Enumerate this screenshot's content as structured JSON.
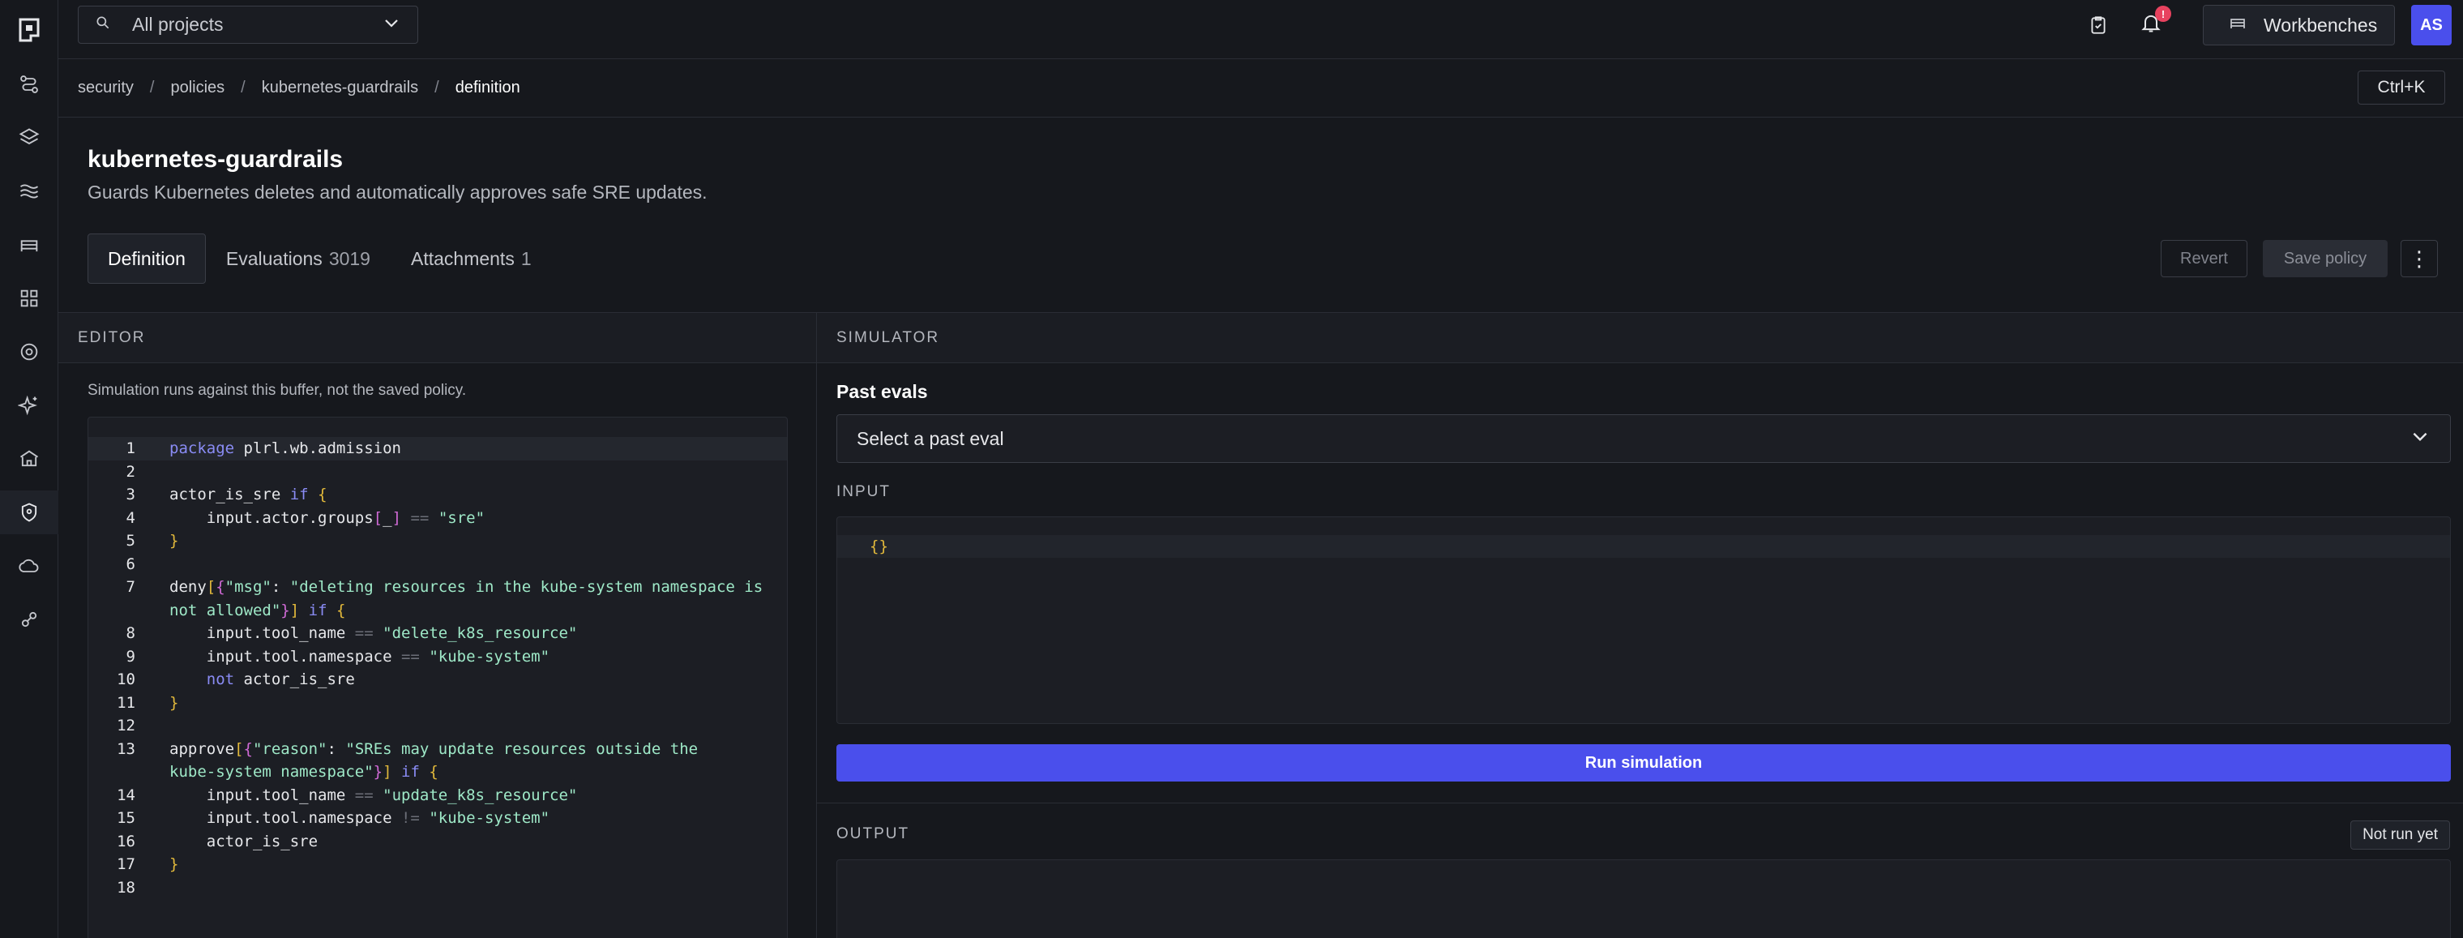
{
  "topbar": {
    "project_select": "All projects",
    "notification_badge": "!",
    "workbenches_label": "Workbenches",
    "avatar_initials": "AS"
  },
  "breadcrumb": {
    "items": [
      "security",
      "policies",
      "kubernetes-guardrails",
      "definition"
    ],
    "separator": "/",
    "shortcut": "Ctrl+K"
  },
  "header": {
    "title": "kubernetes-guardrails",
    "subtitle": "Guards Kubernetes deletes and automatically approves safe SRE updates.",
    "tabs": [
      {
        "label": "Definition",
        "count": ""
      },
      {
        "label": "Evaluations",
        "count": "3019"
      },
      {
        "label": "Attachments",
        "count": "1"
      }
    ],
    "revert_label": "Revert",
    "save_label": "Save policy",
    "more_label": "⋮"
  },
  "editor": {
    "heading": "EDITOR",
    "note": "Simulation runs against this buffer, not the saved policy.",
    "line_numbers": [
      "1",
      "2",
      "3",
      "4",
      "5",
      "6",
      "7",
      "",
      "8",
      "9",
      "10",
      "11",
      "12",
      "13",
      "",
      "14",
      "15",
      "16",
      "17",
      "18"
    ]
  },
  "simulator": {
    "heading": "SIMULATOR",
    "past_evals_label": "Past evals",
    "select_placeholder": "Select a past eval",
    "input_label": "INPUT",
    "input_value": "{}",
    "run_label": "Run simulation",
    "output_label": "OUTPUT",
    "output_status": "Not run yet"
  },
  "colors": {
    "accent": "#4a4fec",
    "background": "#16181d",
    "keyword": "#8a8cf5",
    "string": "#9ee8c7",
    "bracket": "#e2b93b",
    "alert": "#e8425f"
  }
}
